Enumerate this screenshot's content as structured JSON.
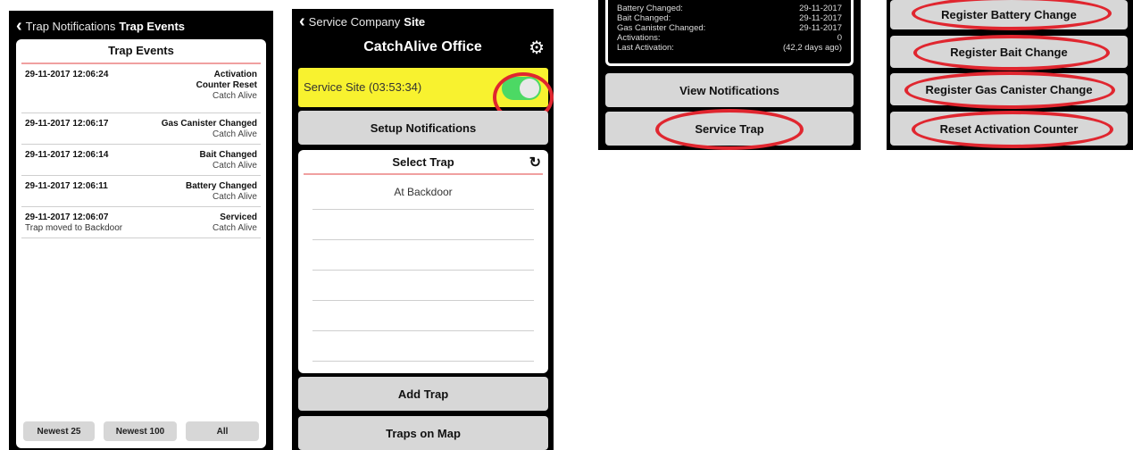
{
  "screen1": {
    "back_label": "Trap Notifications",
    "title": "Trap Events",
    "panel_title": "Trap Events",
    "events": [
      {
        "timestamp": "29-11-2017 12:06:24",
        "lines": [
          "Activation",
          "Counter Reset"
        ],
        "source": "Catch Alive",
        "note": ""
      },
      {
        "timestamp": "29-11-2017 12:06:17",
        "lines": [
          "Gas Canister Changed"
        ],
        "source": "Catch Alive",
        "note": ""
      },
      {
        "timestamp": "29-11-2017 12:06:14",
        "lines": [
          "Bait Changed"
        ],
        "source": "Catch Alive",
        "note": ""
      },
      {
        "timestamp": "29-11-2017 12:06:11",
        "lines": [
          "Battery Changed"
        ],
        "source": "Catch Alive",
        "note": ""
      },
      {
        "timestamp": "29-11-2017 12:06:07",
        "lines": [
          "Serviced"
        ],
        "source": "Catch Alive",
        "note": "Trap moved to Backdoor"
      }
    ],
    "filters": [
      "Newest 25",
      "Newest 100",
      "All"
    ]
  },
  "screen2": {
    "back_label": "Service Company",
    "title": "Site",
    "heading": "CatchAlive Office",
    "service_site_label": "Service Site (03:53:34)",
    "service_site_on": true,
    "setup_notifications": "Setup Notifications",
    "select_trap_title": "Select Trap",
    "traps": [
      "At Backdoor"
    ],
    "add_trap": "Add Trap",
    "traps_on_map": "Traps on Map"
  },
  "screen3": {
    "info": [
      {
        "label": "Battery Changed:",
        "value": "29-11-2017"
      },
      {
        "label": "Bait Changed:",
        "value": "29-11-2017"
      },
      {
        "label": "Gas Canister Changed:",
        "value": "29-11-2017"
      },
      {
        "label": "Activations:",
        "value": "0"
      },
      {
        "label": "Last Activation:",
        "value": "(42,2 days ago)"
      }
    ],
    "view_notifications": "View Notifications",
    "service_trap": "Service Trap"
  },
  "screen4": {
    "buttons": [
      "Register Battery Change",
      "Register Bait Change",
      "Register Gas Canister Change",
      "Reset Activation Counter"
    ]
  },
  "colors": {
    "highlight": "#e0262f",
    "toggle_on": "#4cd964",
    "service_bar": "#f8f22f"
  }
}
